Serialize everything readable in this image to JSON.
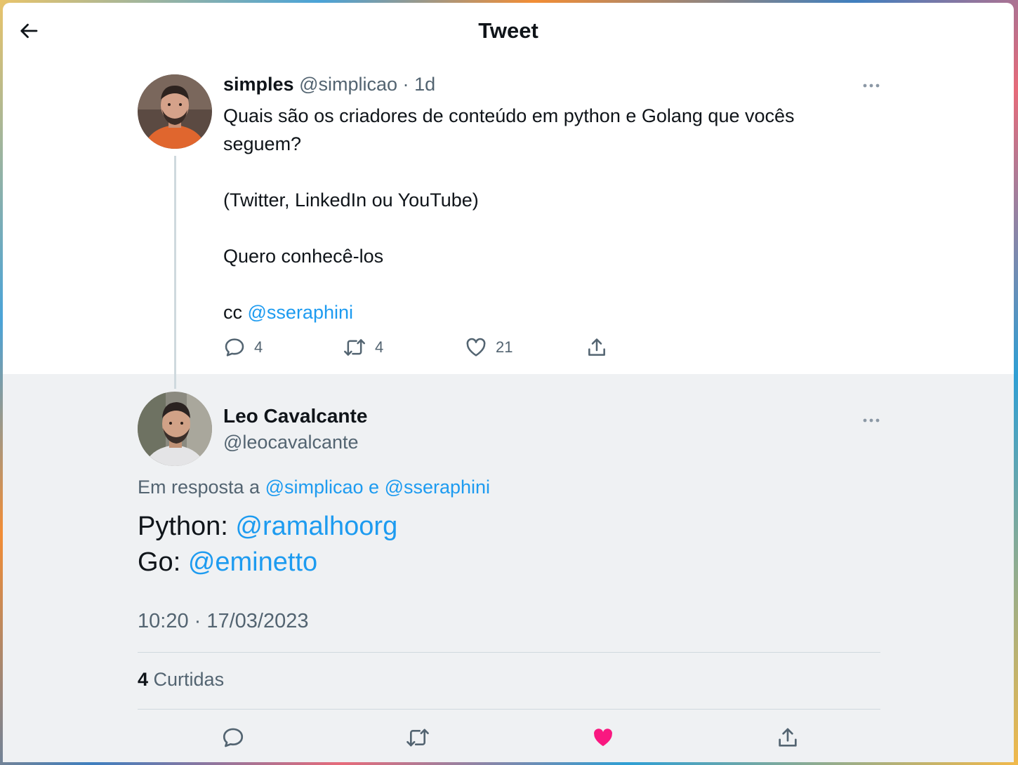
{
  "header": {
    "title": "Tweet",
    "back_icon": "arrow-left-icon"
  },
  "parent_tweet": {
    "author_name": "simples",
    "author_handle": "@simplicao",
    "separator": "·",
    "age": "1d",
    "lines": {
      "line1": "Quais são os criadores de conteúdo em python e Golang que vocês seguem?",
      "line2": "(Twitter, LinkedIn ou YouTube)",
      "line3": "Quero conhecê-los",
      "cc_prefix": "cc ",
      "cc_mention": "@sseraphini"
    },
    "stats": {
      "replies": "4",
      "retweets": "4",
      "likes": "21"
    }
  },
  "reply_tweet": {
    "author_name": "Leo Cavalcante",
    "author_handle": "@leocavalcante",
    "reply_prefix": "Em resposta a ",
    "reply_mention_1": "@simplicao",
    "reply_joiner": " e ",
    "reply_mention_2": "@sseraphini",
    "python_prefix": "Python: ",
    "python_mention": "@ramalhoorg",
    "go_prefix": "Go: ",
    "go_mention": "@eminetto",
    "timestamp": "10:20 · 17/03/2023",
    "likes_count": "4",
    "likes_label": " Curtidas",
    "liked": true
  },
  "colors": {
    "accent": "#1d9bf0",
    "like": "#f91880",
    "text": "#0f1419",
    "muted": "#536471",
    "focused_bg": "#eff1f3"
  }
}
